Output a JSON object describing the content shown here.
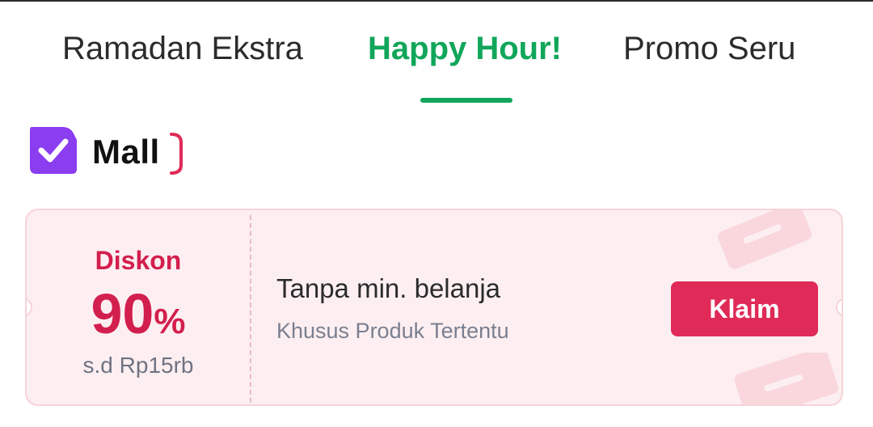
{
  "tabs": [
    {
      "label": "Ramadan Ekstra",
      "active": false
    },
    {
      "label": "Happy Hour!",
      "active": true
    },
    {
      "label": "Promo Seru",
      "active": false
    }
  ],
  "colors": {
    "accent_green": "#11a65a",
    "discount_red": "#d31f4e",
    "button_red": "#e02a57",
    "mall_purple": "#8b3df0",
    "voucher_bg": "#fdeff1"
  },
  "store_badge": {
    "icon": "mall-check-icon",
    "label": "Mall"
  },
  "voucher": {
    "discount_label": "Diskon",
    "discount_value": "90",
    "discount_unit": "%",
    "max_discount": "s.d Rp15rb",
    "title": "Tanpa min. belanja",
    "subtitle": "Khusus Produk Tertentu",
    "claim_label": "Klaim"
  }
}
